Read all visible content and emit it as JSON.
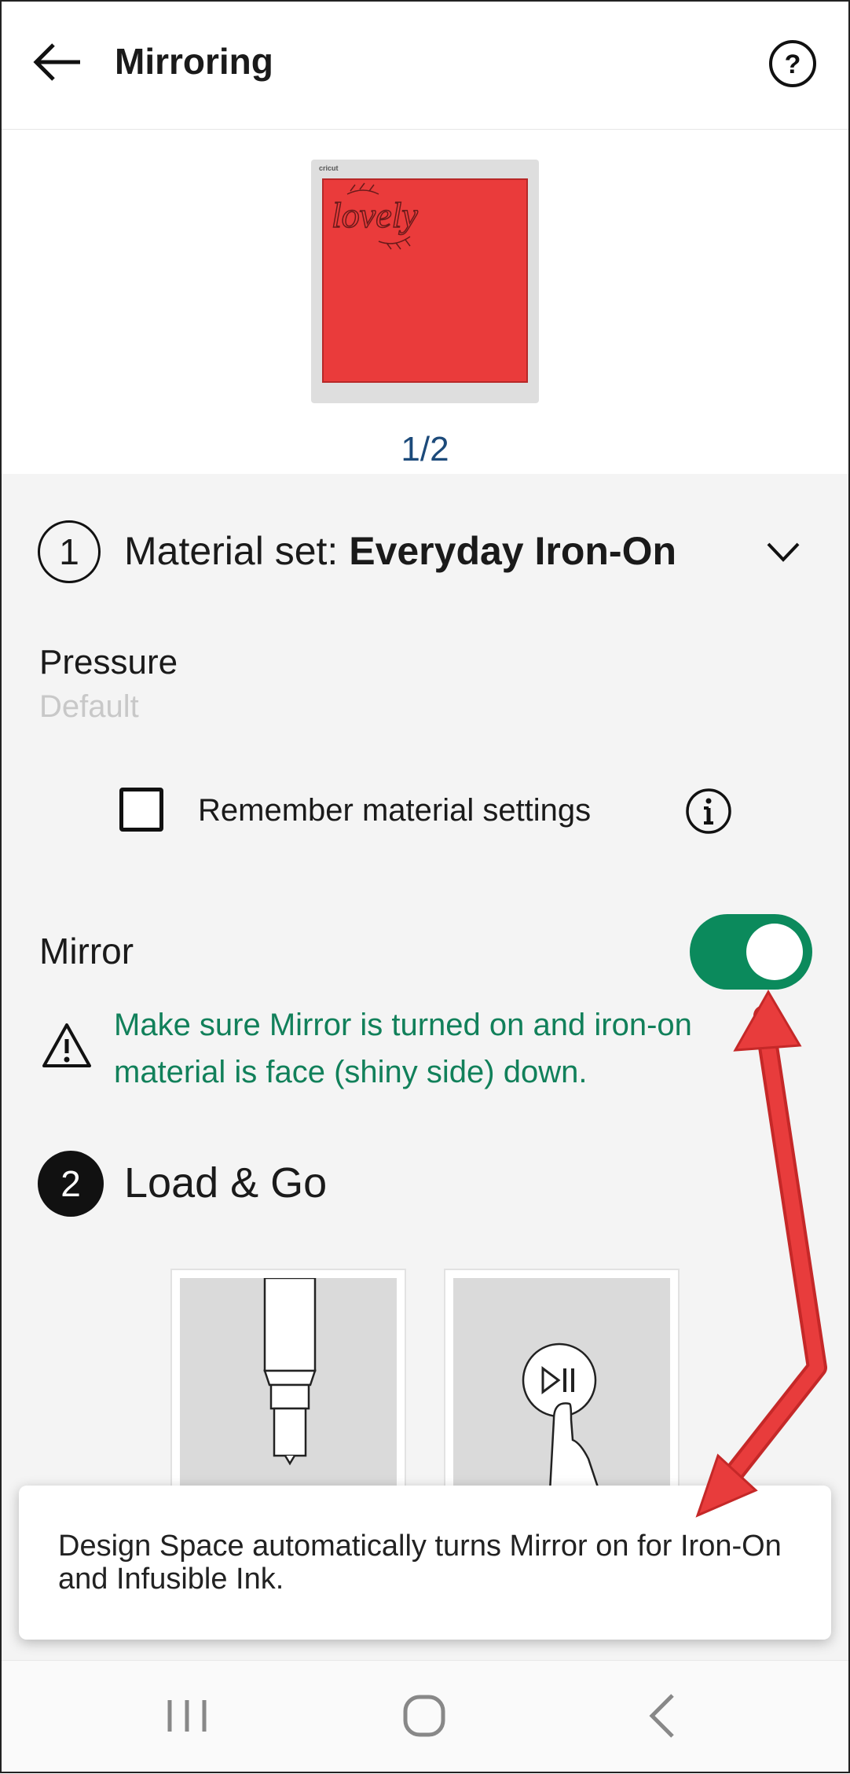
{
  "header": {
    "title": "Mirroring",
    "back_icon": "arrow-left-icon",
    "help_icon": "question-circle-icon"
  },
  "preview": {
    "mat_brand": "cricut",
    "mat_text": "lovely",
    "page_indicator": "1/2"
  },
  "material": {
    "step": "1",
    "label_prefix": "Material set: ",
    "label_value": "Everyday Iron-On"
  },
  "pressure": {
    "label": "Pressure",
    "value": "Default"
  },
  "remember": {
    "label": "Remember material settings",
    "checked": false
  },
  "mirror": {
    "label": "Mirror",
    "on": true,
    "warning": "Make sure Mirror is turned on and iron-on material is face (shiny side) down."
  },
  "load": {
    "step": "2",
    "label": "Load & Go"
  },
  "toast": {
    "text": "Design Space automatically turns Mirror on for Iron-On and Infusible Ink."
  },
  "colors": {
    "accent": "#0b8a5c",
    "warning_text": "#11805a",
    "mat": "#ea3b3b",
    "annotation": "#e83c3c"
  }
}
